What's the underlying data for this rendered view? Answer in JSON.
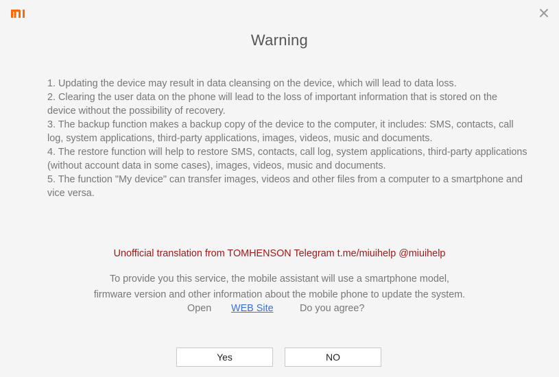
{
  "window": {
    "logo_icon": "mi-logo-icon",
    "close_icon": "close-icon",
    "accent_color": "#ff6700"
  },
  "dialog": {
    "title": "Warning",
    "items": [
      "1. Updating the device may result in data cleansing on the device, which will lead to data loss.",
      "2. Clearing the user data on the phone will lead to the loss of important information that is stored on the device without the possibility of recovery.",
      "3. The backup function makes a backup copy of the device to the computer, it includes: SMS, contacts, call log, system applications, third-party applications, images, videos, music and documents.",
      "4. The restore function will help to restore SMS, contacts, call log, system applications, third-party applications (without account data in some cases), images, videos, music and documents.",
      "5. The function \"My device\" can transfer images, videos and other files from a computer to a smartphone and vice versa."
    ],
    "translation_note": "Unofficial translation from TOMHENSON Telegram t.me/miuihelp @miuihelp",
    "consent_line1": "To provide you this service, the mobile assistant will use a smartphone model,",
    "consent_line2": "firmware version and other information about the mobile phone to update the system.",
    "open_label": "Open",
    "web_link": "WEB Site",
    "agree_question": "Do you agree?",
    "yes_label": "Yes",
    "no_label": "NO"
  }
}
